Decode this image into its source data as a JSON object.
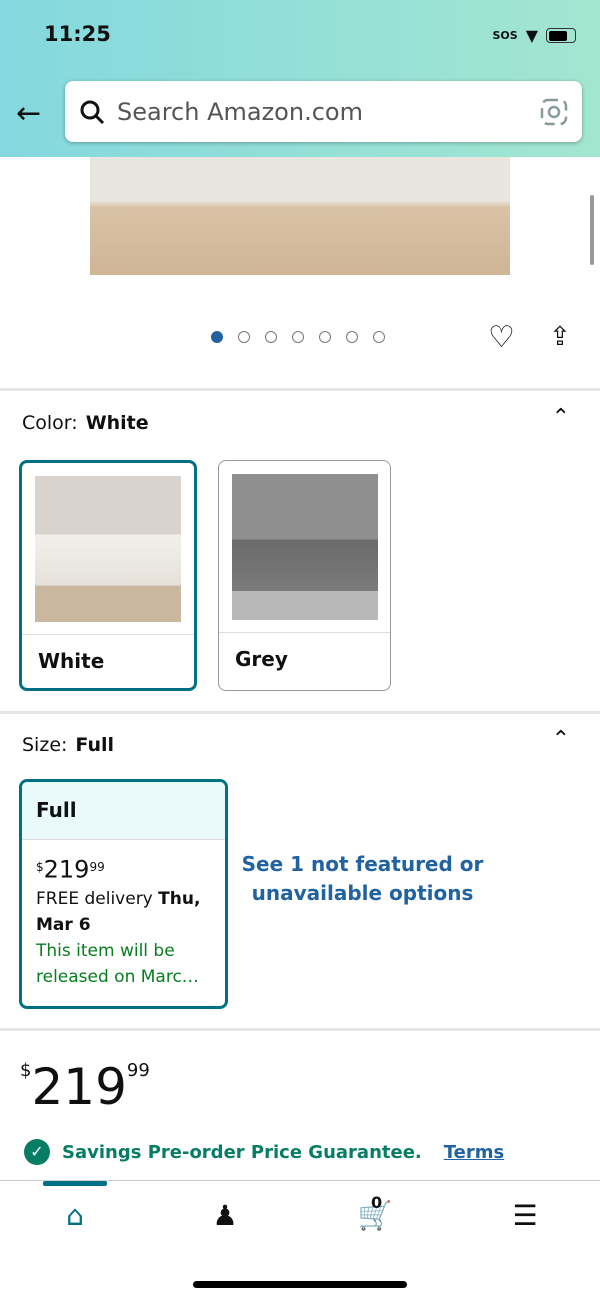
{
  "status_bar": {
    "time": "11:25",
    "sos": "SOS"
  },
  "search": {
    "placeholder": "Search Amazon.com"
  },
  "carousel": {
    "total": 7,
    "active": 1
  },
  "color": {
    "label": "Color:",
    "selected": "White",
    "options": [
      {
        "name": "White",
        "selected": true
      },
      {
        "name": "Grey",
        "selected": false
      }
    ]
  },
  "size": {
    "label": "Size:",
    "selected": "Full",
    "card": {
      "name": "Full",
      "price_symbol": "$",
      "price_whole": "219",
      "price_fraction": "99",
      "delivery_prefix": "FREE delivery ",
      "delivery_date": "Thu, Mar 6",
      "release": "This item will be released on Marc…"
    },
    "more_options": "See 1 not featured or unavailable options"
  },
  "price": {
    "symbol": "$",
    "whole": "219",
    "fraction": "99"
  },
  "guarantee": {
    "text": "Savings Pre-order Price Guarantee.",
    "terms": "Terms"
  },
  "nav": {
    "cart_count": "0",
    "items": [
      "home-icon",
      "account-icon",
      "cart-icon",
      "menu-icon"
    ]
  },
  "colors": {
    "accent": "#007185",
    "link": "#2162a1",
    "green": "#067d1e"
  }
}
